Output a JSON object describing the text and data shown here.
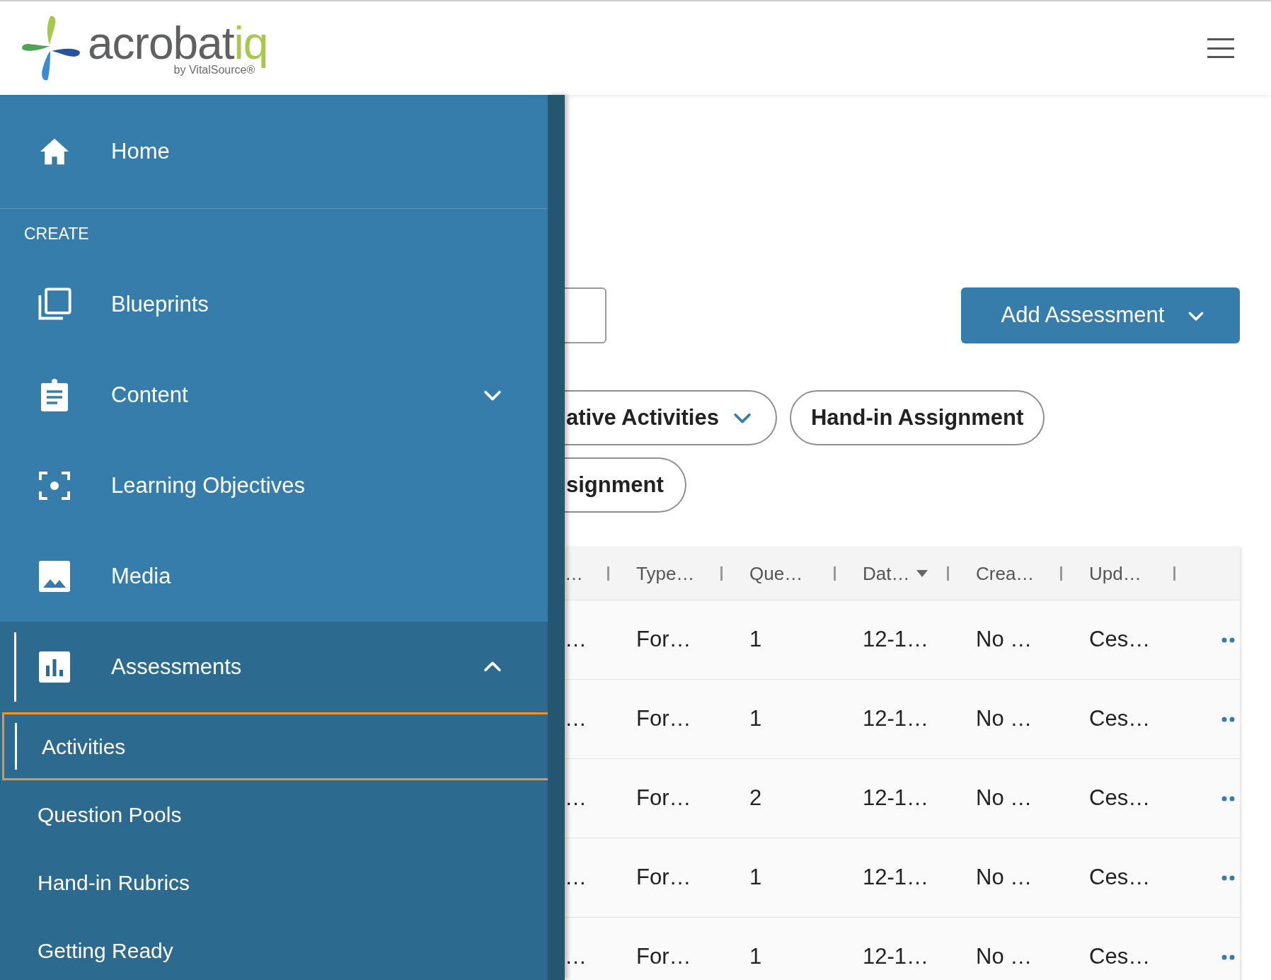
{
  "header": {
    "logo": {
      "word": "acrobat",
      "accent": "iq",
      "by": "by",
      "brand": "VitalSource®"
    }
  },
  "sidebar": {
    "home": {
      "label": "Home",
      "selected": false
    },
    "section_label": "CREATE",
    "items": [
      {
        "label": "Blueprints",
        "kind": "link",
        "selected": false
      },
      {
        "label": "Content",
        "kind": "group",
        "expanded": false,
        "selected": false
      },
      {
        "label": "Learning Objectives",
        "kind": "link",
        "selected": false
      },
      {
        "label": "Media",
        "kind": "link",
        "selected": false
      },
      {
        "label": "Assessments",
        "kind": "group",
        "expanded": true,
        "selected": true,
        "children": [
          {
            "label": "Activities",
            "selected": true,
            "focused": true
          },
          {
            "label": "Question Pools",
            "selected": false,
            "focused": false
          },
          {
            "label": "Hand-in Rubrics",
            "selected": false,
            "focused": false
          },
          {
            "label": "Getting Ready",
            "selected": false,
            "focused": false
          }
        ]
      }
    ]
  },
  "toolbar": {
    "add_button": {
      "label": "Add Assessment"
    }
  },
  "filter_rows": [
    [
      {
        "label": "ative Activities",
        "dropdown": true
      },
      {
        "label": "Hand-in Assignment",
        "dropdown": false
      }
    ],
    [
      {
        "label": "signment",
        "dropdown": false
      }
    ]
  ],
  "table": {
    "columns": [
      {
        "label": "…",
        "sorted": false
      },
      {
        "label": "Type…",
        "sorted": false
      },
      {
        "label": "Que…",
        "sorted": false
      },
      {
        "label": "Dat…",
        "sorted": true
      },
      {
        "label": "Crea…",
        "sorted": false
      },
      {
        "label": "Upd…",
        "sorted": false
      }
    ],
    "rows": [
      [
        "…",
        "For…",
        "1",
        "12-1…",
        "No …",
        "Ces…"
      ],
      [
        "…",
        "For…",
        "1",
        "12-1…",
        "No …",
        "Ces…"
      ],
      [
        "…",
        "For…",
        "2",
        "12-1…",
        "No …",
        "Ces…"
      ],
      [
        "…",
        "For…",
        "1",
        "12-1…",
        "No …",
        "Ces…"
      ],
      [
        "…",
        "For…",
        "1",
        "12-1…",
        "No …",
        "Ces…"
      ]
    ]
  }
}
